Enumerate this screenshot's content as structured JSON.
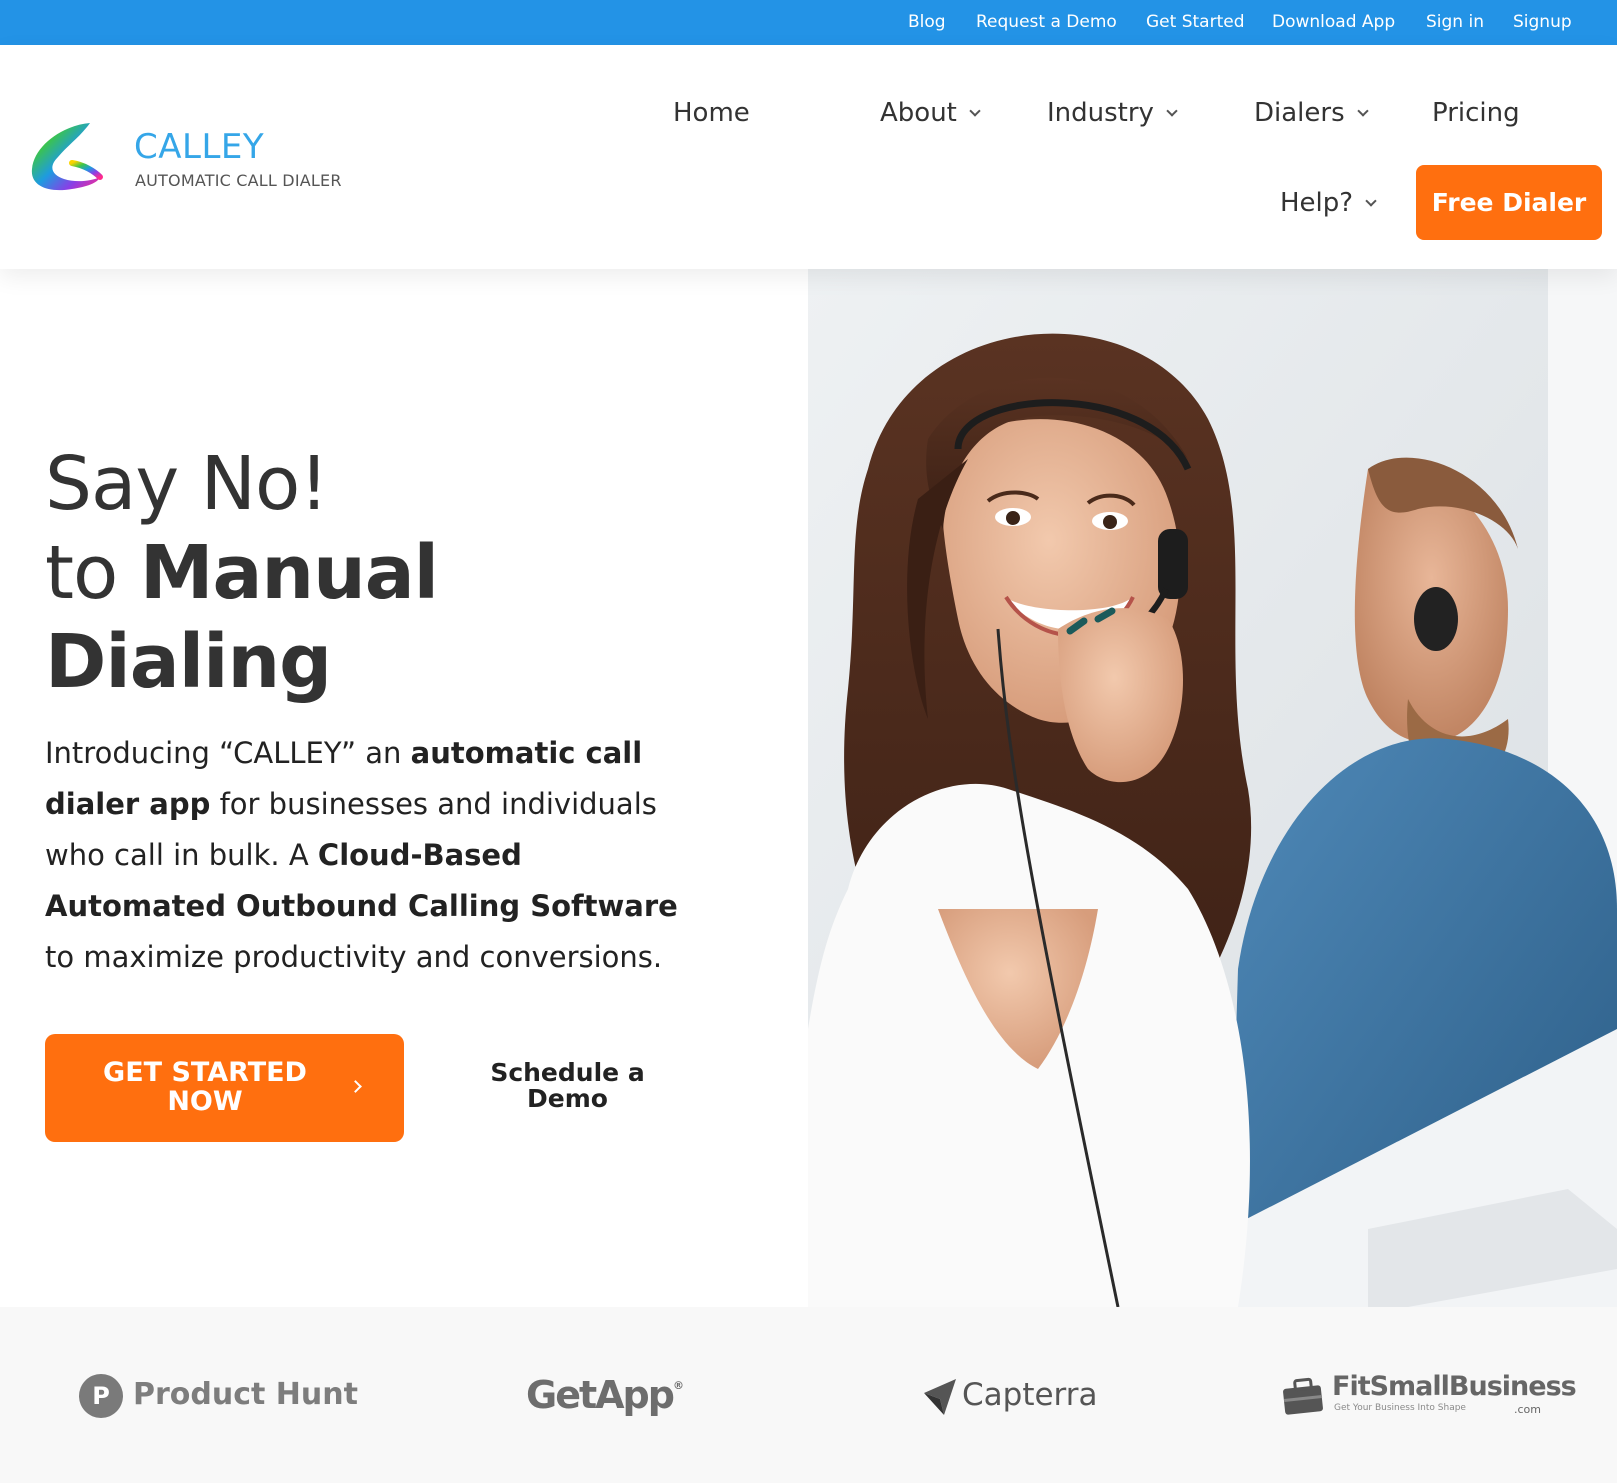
{
  "topbar": {
    "links": [
      "Blog",
      "Request a Demo",
      "Get Started",
      "Download App",
      "Sign in",
      "Signup"
    ]
  },
  "brand": {
    "name": "CALLEY",
    "tagline": "AUTOMATIC CALL DIALER"
  },
  "nav": {
    "home": "Home",
    "about": "About",
    "industry": "Industry",
    "dialers": "Dialers",
    "pricing": "Pricing",
    "help": "Help?",
    "cta": "Free Dialer"
  },
  "hero": {
    "line1": "Say No!",
    "line2_prefix": "to ",
    "line2_bold": "Manual",
    "line3_bold": "Dialing",
    "intro": {
      "p1": "Introducing “CALLEY” an ",
      "b1": "automatic call dialer app",
      "p2": " for businesses and individuals who call in bulk. A ",
      "b2": "Cloud-Based Automated Outbound Calling Software",
      "p3": " to maximize productivity and conversions."
    },
    "primary_cta": "GET STARTED NOW",
    "secondary_cta": "Schedule a Demo"
  },
  "partners": {
    "product_hunt": "Product Hunt",
    "product_hunt_badge": "P",
    "getapp": "GetApp",
    "getapp_mark": "®",
    "capterra": "Capterra",
    "fitsmallbusiness": "FitSmallBusiness",
    "fitsmallbusiness_tagline": "Get Your Business Into Shape",
    "fitsmallbusiness_suffix": ".com"
  },
  "colors": {
    "topbar": "#2393e6",
    "accent_orange": "#ff6f0f",
    "brand_blue": "#35a6e8"
  }
}
